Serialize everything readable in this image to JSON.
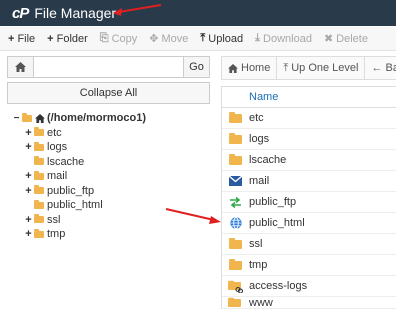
{
  "titlebar": {
    "logo": "cP",
    "title": "File Manager"
  },
  "toolbar": {
    "items": [
      {
        "icon": "+",
        "label": "File",
        "enabled": true
      },
      {
        "icon": "+",
        "label": "Folder",
        "enabled": true
      },
      {
        "icon": "⎘",
        "label": "Copy",
        "enabled": false
      },
      {
        "icon": "✥",
        "label": "Move",
        "enabled": false
      },
      {
        "icon": "⤒",
        "label": "Upload",
        "enabled": true
      },
      {
        "icon": "⤓",
        "label": "Download",
        "enabled": false
      },
      {
        "icon": "✖",
        "label": "Delete",
        "enabled": false
      }
    ]
  },
  "left": {
    "home_icon": "🏠",
    "path_value": "",
    "go_label": "Go",
    "collapse_label": "Collapse All",
    "root_label": "(/home/mormoco1)",
    "tree": [
      {
        "label": "etc",
        "expand": "+"
      },
      {
        "label": "logs",
        "expand": "+"
      },
      {
        "label": "lscache",
        "expand": ""
      },
      {
        "label": "mail",
        "expand": "+"
      },
      {
        "label": "public_ftp",
        "expand": "+"
      },
      {
        "label": "public_html",
        "expand": ""
      },
      {
        "label": "ssl",
        "expand": "+"
      },
      {
        "label": "tmp",
        "expand": "+"
      }
    ]
  },
  "right": {
    "nav": [
      {
        "icon": "🏠",
        "label": "Home"
      },
      {
        "icon": "⤒",
        "label": "Up One Level"
      },
      {
        "icon": "←",
        "label": "Bac"
      }
    ],
    "column_name": "Name",
    "rows": [
      {
        "name": "etc",
        "icon": "folder-icon"
      },
      {
        "name": "logs",
        "icon": "folder-icon"
      },
      {
        "name": "lscache",
        "icon": "folder-icon"
      },
      {
        "name": "mail",
        "icon": "mail-icon"
      },
      {
        "name": "public_ftp",
        "icon": "ftp-icon"
      },
      {
        "name": "public_html",
        "icon": "globe-icon"
      },
      {
        "name": "ssl",
        "icon": "folder-icon"
      },
      {
        "name": "tmp",
        "icon": "folder-icon"
      },
      {
        "name": "access-logs",
        "icon": "folder-link-icon"
      },
      {
        "name": "www",
        "icon": "folder-link-icon"
      }
    ]
  },
  "colors": {
    "titlebar": "#293a4a",
    "folder": "#f0b64d",
    "link": "#1a6fb3",
    "annotation_arrow": "#e02020"
  }
}
